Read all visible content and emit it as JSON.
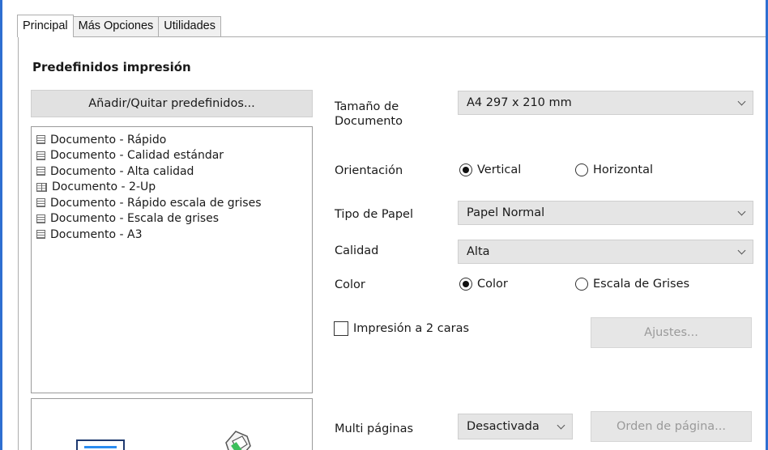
{
  "tabs": [
    "Principal",
    "Más Opciones",
    "Utilidades"
  ],
  "presets": {
    "title": "Predefinidos impresión",
    "add_remove_label": "Añadir/Quitar predefinidos...",
    "items": [
      {
        "label": "Documento - Rápido",
        "icon": "document-icon"
      },
      {
        "label": "Documento - Calidad estándar",
        "icon": "document-icon"
      },
      {
        "label": "Documento - Alta calidad",
        "icon": "document-icon"
      },
      {
        "label": "Documento - 2-Up",
        "icon": "two-up-icon"
      },
      {
        "label": "Documento - Rápido escala de grises",
        "icon": "document-icon"
      },
      {
        "label": "Documento - Escala de grises",
        "icon": "document-icon"
      },
      {
        "label": "Documento - A3",
        "icon": "document-icon"
      }
    ]
  },
  "settings": {
    "doc_size_label": "Tamaño de Documento",
    "doc_size_value": "A4 297 x 210 mm",
    "orientation_label": "Orientación",
    "orientation_options": [
      "Vertical",
      "Horizontal"
    ],
    "orientation_selected": "Vertical",
    "paper_type_label": "Tipo de Papel",
    "paper_type_value": "Papel Normal",
    "quality_label": "Calidad",
    "quality_value": "Alta",
    "color_label": "Color",
    "color_options": [
      "Color",
      "Escala de Grises"
    ],
    "color_selected": "Color",
    "duplex_label": "Impresión a 2 caras",
    "duplex_checked": false,
    "settings_button": "Ajustes...",
    "multipage_label": "Multi páginas",
    "multipage_value": "Desactivada",
    "page_order_button": "Orden de página..."
  },
  "colors": {
    "frame": "#2e6fd1",
    "button_bg": "#e1e1e1",
    "select_bg": "#e5e5e5"
  }
}
